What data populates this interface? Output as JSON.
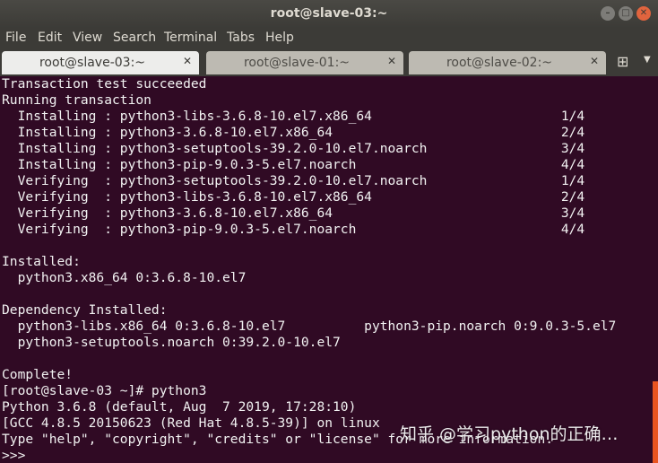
{
  "window": {
    "title": "root@slave-03:~",
    "buttons": [
      "minimize-icon",
      "maximize-icon",
      "close-icon"
    ]
  },
  "menu": [
    "File",
    "Edit",
    "View",
    "Search",
    "Terminal",
    "Tabs",
    "Help"
  ],
  "tabs": [
    {
      "label": "root@slave-03:~",
      "active": true
    },
    {
      "label": "root@slave-01:~",
      "active": false
    },
    {
      "label": "root@slave-02:~",
      "active": false
    }
  ],
  "tab_controls": {
    "new_tab_icon": "new-tab-icon",
    "menu_icon": "chevron-down-icon"
  },
  "terminal": {
    "lines": [
      "Transaction test succeeded",
      "Running transaction",
      "  Installing : python3-libs-3.6.8-10.el7.x86_64                        1/4",
      "  Installing : python3-3.6.8-10.el7.x86_64                             2/4",
      "  Installing : python3-setuptools-39.2.0-10.el7.noarch                 3/4",
      "  Installing : python3-pip-9.0.3-5.el7.noarch                          4/4",
      "  Verifying  : python3-setuptools-39.2.0-10.el7.noarch                 1/4",
      "  Verifying  : python3-libs-3.6.8-10.el7.x86_64                        2/4",
      "  Verifying  : python3-3.6.8-10.el7.x86_64                             3/4",
      "  Verifying  : python3-pip-9.0.3-5.el7.noarch                          4/4",
      "",
      "Installed:",
      "  python3.x86_64 0:3.6.8-10.el7",
      "",
      "Dependency Installed:",
      "  python3-libs.x86_64 0:3.6.8-10.el7          python3-pip.noarch 0:9.0.3-5.el7",
      "  python3-setuptools.noarch 0:39.2.0-10.el7",
      "",
      "Complete!",
      "[root@slave-03 ~]# python3",
      "Python 3.6.8 (default, Aug  7 2019, 17:28:10)",
      "[GCC 4.8.5 20150623 (Red Hat 4.8.5-39)] on linux",
      "Type \"help\", \"copyright\", \"credits\" or \"license\" for more information.",
      ">>> "
    ]
  },
  "watermark": "知乎 @学习python的正确…",
  "colors": {
    "terminal_bg": "#300a24",
    "terminal_fg": "#f2f2f2",
    "titlebar": "#3c3b37",
    "close_button": "#e0643e",
    "scrollbar": "#e95420"
  }
}
